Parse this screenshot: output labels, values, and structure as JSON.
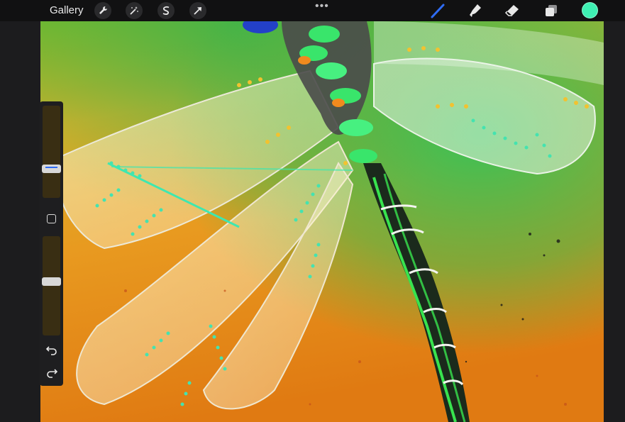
{
  "topbar": {
    "gallery_label": "Gallery",
    "left_tools": [
      "wrench-icon",
      "magic-wand-icon",
      "selection-icon",
      "transform-arrow-icon"
    ],
    "more_label": "•••",
    "right_tools": [
      "brush-icon",
      "smudge-icon",
      "eraser-icon",
      "layers-icon"
    ],
    "active_tool": "brush-icon",
    "current_color": "#3ef0b2"
  },
  "sidebar": {
    "brush_size_level": 0.3,
    "opacity_level": 0.55,
    "undo_icon": "undo-icon",
    "redo_icon": "redo-icon"
  },
  "colors": {
    "toolbar_bg": "#111112",
    "active_brush": "#2f6cf4",
    "accent_teal": "#3ef0b2"
  }
}
